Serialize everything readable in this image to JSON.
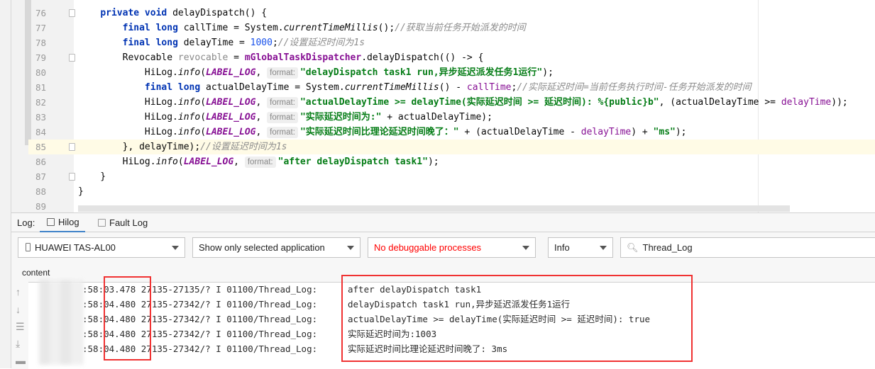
{
  "editor": {
    "lines": [
      {
        "n": "76",
        "fold": true,
        "tokens": [
          [
            "",
            "    "
          ],
          [
            "kw",
            "private void "
          ],
          [
            "",
            "delayDispatch() {"
          ]
        ]
      },
      {
        "n": "77",
        "tokens": [
          [
            "",
            "        "
          ],
          [
            "kw",
            "final long "
          ],
          [
            "",
            "callTime = System."
          ],
          [
            "it",
            "currentTimeMillis"
          ],
          [
            "",
            "();"
          ],
          [
            "cm",
            "//获取当前任务开始派发的时间"
          ]
        ]
      },
      {
        "n": "78",
        "tokens": [
          [
            "",
            "        "
          ],
          [
            "kw",
            "final long "
          ],
          [
            "",
            "delayTime = "
          ],
          [
            "num",
            "1000"
          ],
          [
            "",
            ";"
          ],
          [
            "cm",
            "//设置延迟时间为1s"
          ]
        ]
      },
      {
        "n": "79",
        "fold": true,
        "tokens": [
          [
            "",
            "        Revocable "
          ],
          [
            "unused",
            "revocable"
          ],
          [
            "",
            " = "
          ],
          [
            "fld",
            "mGlobalTaskDispatcher"
          ],
          [
            "",
            ".delayDispatch(() -> {"
          ]
        ]
      },
      {
        "n": "80",
        "tokens": [
          [
            "",
            "            HiLog."
          ],
          [
            "it",
            "info"
          ],
          [
            "",
            "("
          ],
          [
            "cst",
            "LABEL_LOG"
          ],
          [
            "",
            ", "
          ],
          [
            "hint",
            "format:"
          ],
          [
            "str",
            "\"delayDispatch task1 run,异步延迟派发任务1运行\""
          ],
          [
            "",
            ");"
          ]
        ]
      },
      {
        "n": "81",
        "tokens": [
          [
            "",
            "            "
          ],
          [
            "kw",
            "final long "
          ],
          [
            "",
            "actualDelayTime = System."
          ],
          [
            "it",
            "currentTimeMillis"
          ],
          [
            "",
            "() - "
          ],
          [
            "var",
            "callTime"
          ],
          [
            "",
            ";"
          ],
          [
            "cm",
            "//实际延迟时间=当前任务执行时间-任务开始派发的时间"
          ]
        ]
      },
      {
        "n": "82",
        "tokens": [
          [
            "",
            "            HiLog."
          ],
          [
            "it",
            "info"
          ],
          [
            "",
            "("
          ],
          [
            "cst",
            "LABEL_LOG"
          ],
          [
            "",
            ", "
          ],
          [
            "hint",
            "format:"
          ],
          [
            "str",
            "\"actualDelayTime >= delayTime(实际延迟时间 >= 延迟时间): %{public}b\""
          ],
          [
            "",
            ", (actualDelayTime >= "
          ],
          [
            "var",
            "delayTime"
          ],
          [
            "",
            "));"
          ]
        ]
      },
      {
        "n": "83",
        "tokens": [
          [
            "",
            "            HiLog."
          ],
          [
            "it",
            "info"
          ],
          [
            "",
            "("
          ],
          [
            "cst",
            "LABEL_LOG"
          ],
          [
            "",
            ", "
          ],
          [
            "hint",
            "format:"
          ],
          [
            "str",
            "\"实际延迟时间为:\""
          ],
          [
            "",
            " + actualDelayTime);"
          ]
        ]
      },
      {
        "n": "84",
        "tokens": [
          [
            "",
            "            HiLog."
          ],
          [
            "it",
            "info"
          ],
          [
            "",
            "("
          ],
          [
            "cst",
            "LABEL_LOG"
          ],
          [
            "",
            ", "
          ],
          [
            "hint",
            "format:"
          ],
          [
            "str",
            "\"实际延迟时间比理论延迟时间晚了：\""
          ],
          [
            "",
            " + (actualDelayTime - "
          ],
          [
            "var",
            "delayTime"
          ],
          [
            "",
            ") + "
          ],
          [
            "str",
            "\"ms\""
          ],
          [
            "",
            ");"
          ]
        ]
      },
      {
        "n": "85",
        "fold": true,
        "highlight": true,
        "tokens": [
          [
            "",
            "        }, delayTime);"
          ],
          [
            "cm",
            "//设置延迟时间为1s"
          ]
        ]
      },
      {
        "n": "86",
        "tokens": [
          [
            "",
            "        HiLog."
          ],
          [
            "it",
            "info"
          ],
          [
            "",
            "("
          ],
          [
            "cst",
            "LABEL_LOG"
          ],
          [
            "",
            ", "
          ],
          [
            "hint",
            "format:"
          ],
          [
            "str",
            "\"after delayDispatch task1\""
          ],
          [
            "",
            ");"
          ]
        ]
      },
      {
        "n": "87",
        "fold": true,
        "tokens": [
          [
            "",
            "    }"
          ]
        ]
      },
      {
        "n": "88",
        "tokens": [
          [
            "",
            "}"
          ]
        ]
      },
      {
        "n": "89",
        "tokens": []
      }
    ]
  },
  "panel": {
    "log_label": "Log:",
    "tabs": [
      {
        "label": "Hilog",
        "active": true
      },
      {
        "label": "Fault Log",
        "active": false
      }
    ],
    "device": "HUAWEI TAS-AL00",
    "app_filter": "Show only selected application",
    "process": "No debuggable processes",
    "process_color": "#ff0000",
    "level": "Info",
    "search_value": "Thread_Log",
    "content_header": "content",
    "rows": [
      {
        "prefix": ":58:03.478 27135-27135/? I 01100/Thread_Log:",
        "msg": "after delayDispatch task1"
      },
      {
        "prefix": ":58:04.480 27135-27342/? I 01100/Thread_Log:",
        "msg": "delayDispatch task1 run,异步延迟派发任务1运行"
      },
      {
        "prefix": ":58:04.480 27135-27342/? I 01100/Thread_Log:",
        "msg": "actualDelayTime >= delayTime(实际延迟时间 >= 延迟时间): true"
      },
      {
        "prefix": ":58:04.480 27135-27342/? I 01100/Thread_Log:",
        "msg": "实际延迟时间为:1003"
      },
      {
        "prefix": ":58:04.480 27135-27342/? I 01100/Thread_Log:",
        "msg": "实际延迟时间比理论延迟时间晚了: 3ms"
      }
    ],
    "annotation_color": "#f03232"
  }
}
